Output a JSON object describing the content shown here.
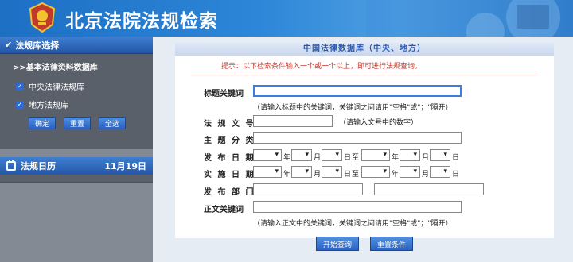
{
  "header": {
    "title": "北京法院法规检索"
  },
  "sidebar": {
    "library_heading": "法规库选择",
    "db_heading": ">>基本法律资料数据库",
    "options": [
      {
        "label": "中央法律法规库",
        "checked": true
      },
      {
        "label": "地方法规库",
        "checked": true
      }
    ],
    "buttons": {
      "confirm": "确定",
      "reset": "重置",
      "select_all": "全选"
    },
    "calendar_heading": "法规日历",
    "calendar_date": "11月19日"
  },
  "main": {
    "panel_title": "中国法律数据库（中央、地方）",
    "hint": "提示：以下检索条件输入一个或一个以上，即可进行法规查询。",
    "fields": {
      "title_keyword": "标题关键词",
      "title_keyword_note": "（请输入标题中的关键词，关键词之间请用\"空格\"或\"；\"隔开）",
      "doc_no": "法 规 文 号",
      "doc_no_note": "（请输入文号中的数字）",
      "subject": "主 题 分 类",
      "publish_date": "发 布 日 期",
      "effective_date": "实 施 日 期",
      "publish_dept": "发 布 部 门",
      "body_keyword": "正文关键词",
      "body_keyword_note": "（请输入正文中的关键词，关键词之间请用\"空格\"或\"；\"隔开）"
    },
    "date_units": {
      "year": "年",
      "month": "月",
      "day": "日",
      "to": "至"
    },
    "buttons": {
      "search": "开始查询",
      "reset": "重置条件"
    }
  },
  "colors": {
    "header_blue": "#2d86d8",
    "sidebar_gray": "#5a606a",
    "hint_red": "#c4392c",
    "button_blue": "#2a62c2"
  }
}
